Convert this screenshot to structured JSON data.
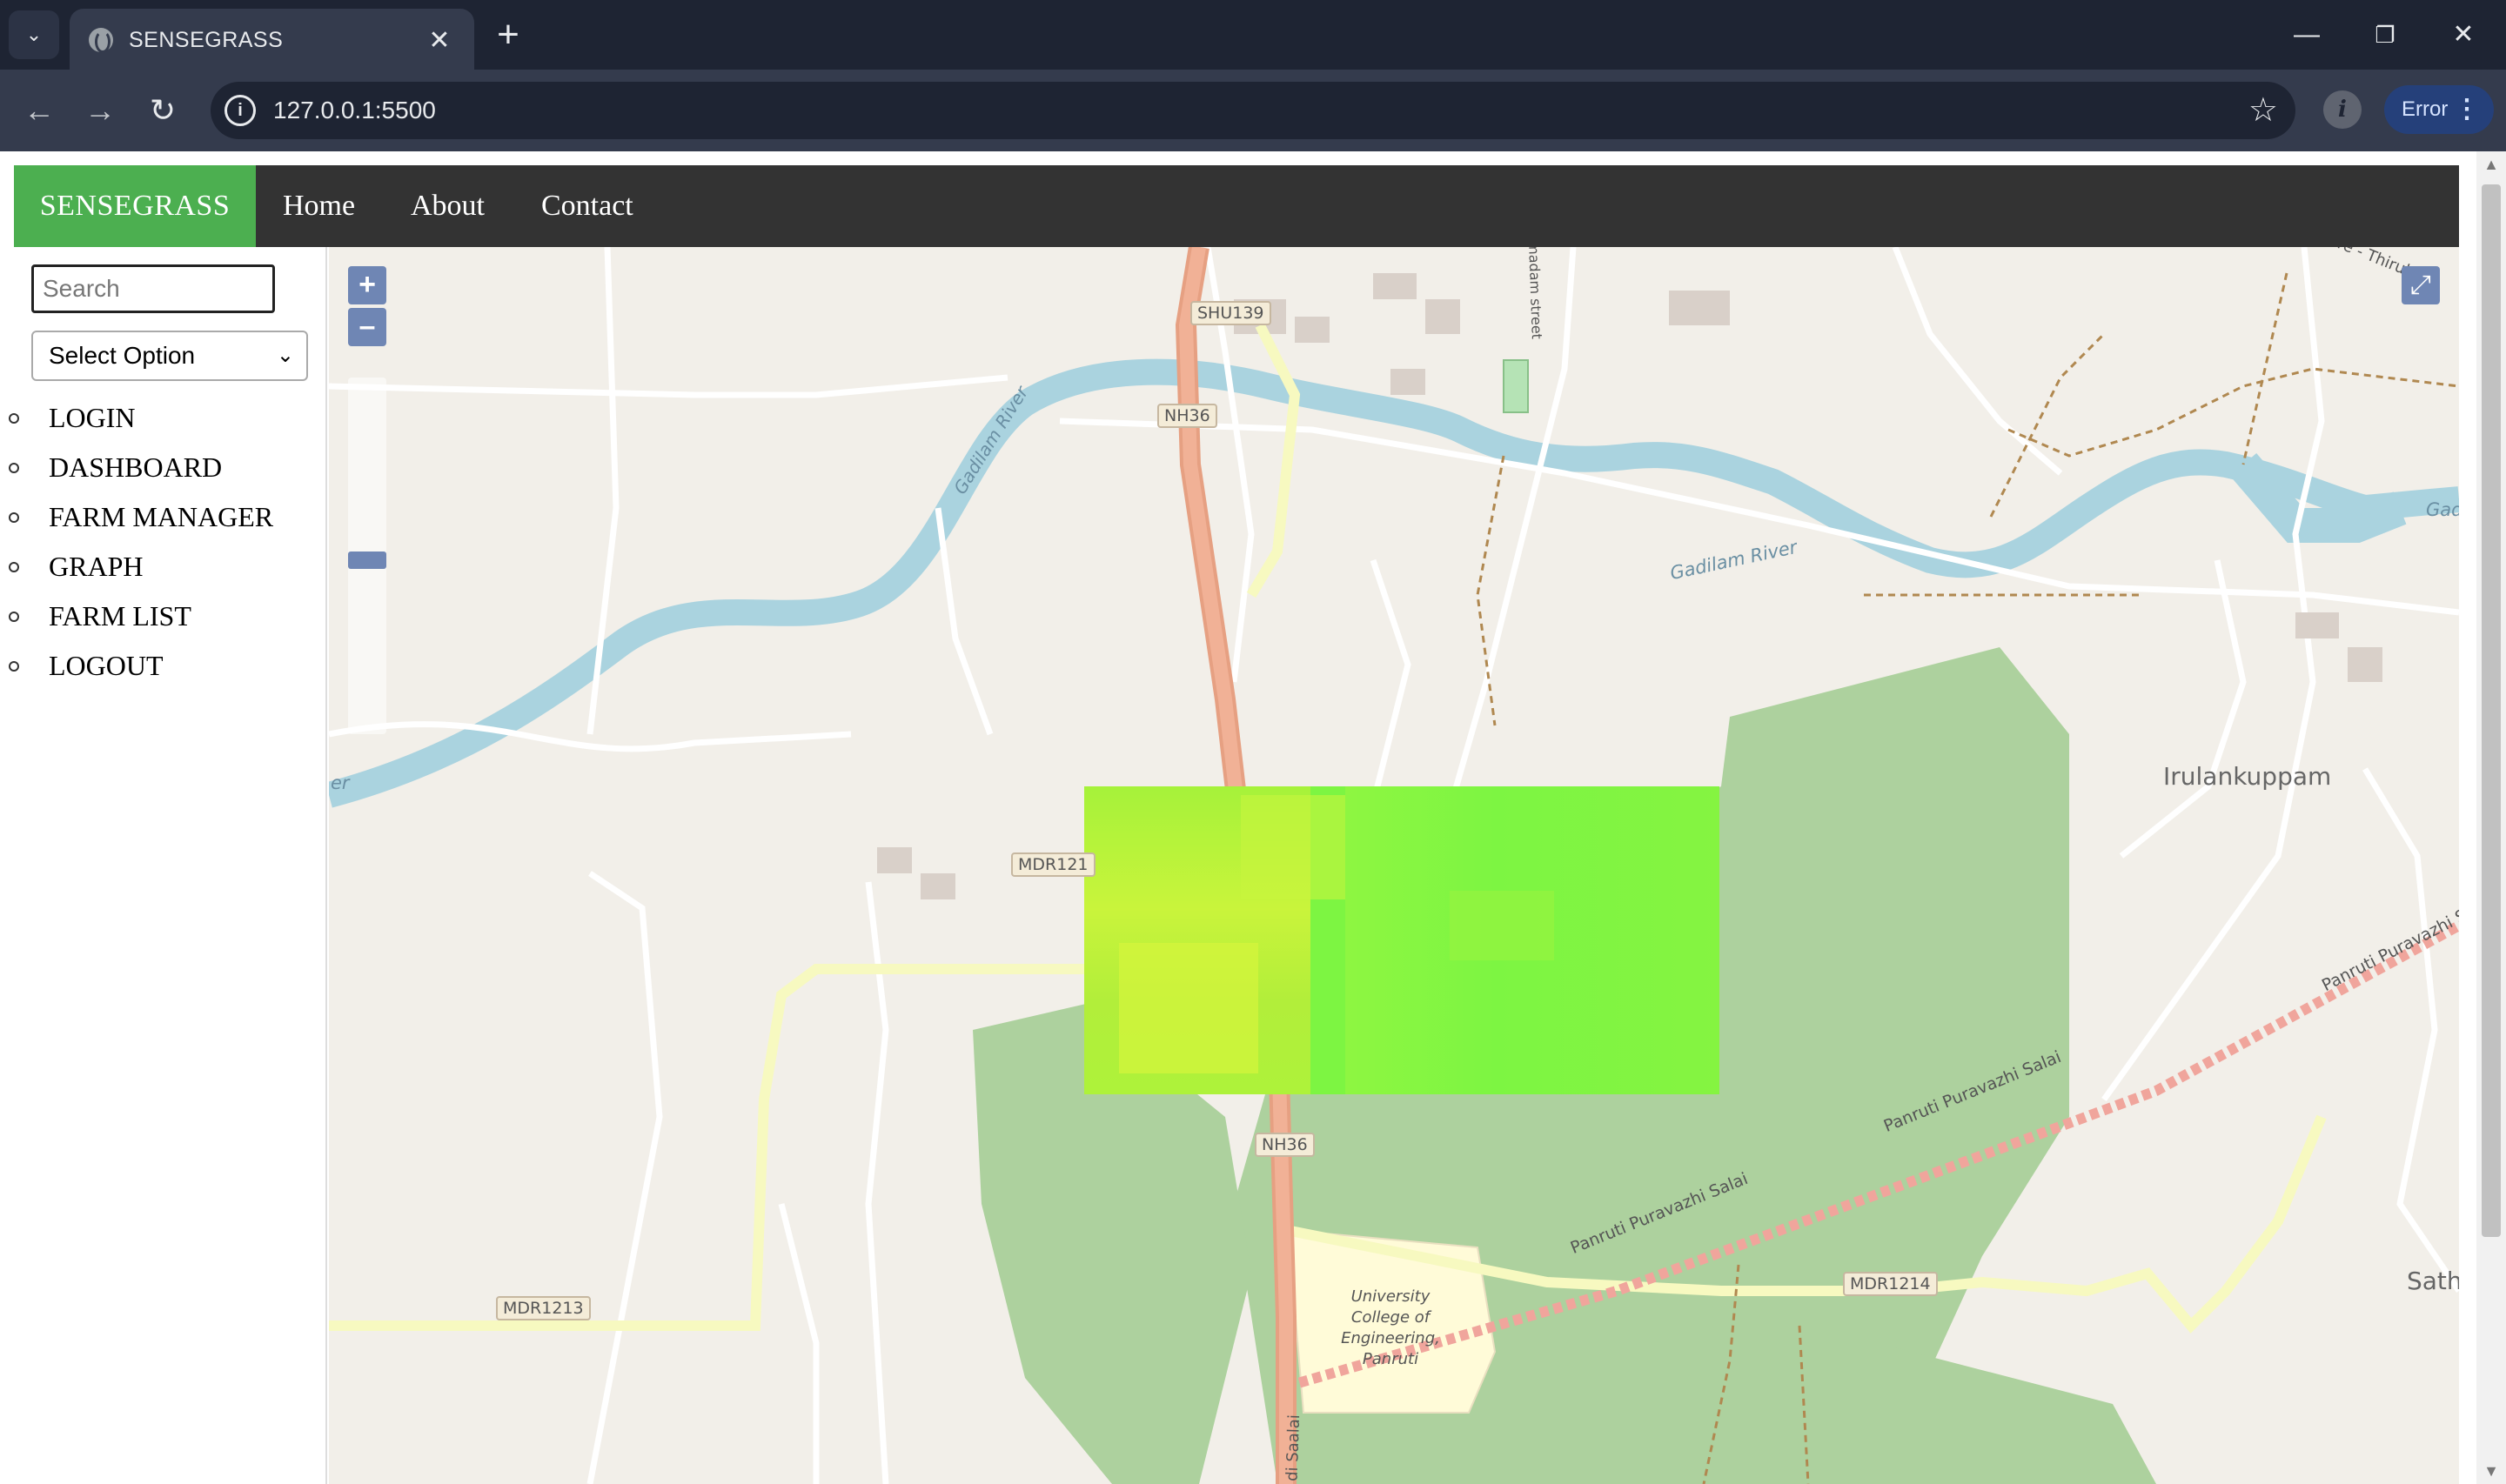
{
  "browser": {
    "tab_title": "SENSEGRASS",
    "url": "127.0.0.1:5500",
    "error_label": "Error"
  },
  "navbar": {
    "brand": "SENSEGRASS",
    "links": [
      "Home",
      "About",
      "Contact"
    ]
  },
  "sidebar": {
    "search_placeholder": "Search",
    "select_value": "Select Option",
    "menu": [
      "LOGIN",
      "DASHBOARD",
      "FARM MANAGER",
      "GRAPH",
      "FARM LIST",
      "LOGOUT"
    ]
  },
  "map": {
    "zoom_in": "+",
    "zoom_out": "–",
    "labels": {
      "river_1": "Gadilam River",
      "river_2": "Gadilam River",
      "river_3": "Gad",
      "river_4": "er",
      "village": "Irulankuppam",
      "road_name_1": "Panruti Puravazhi Salai",
      "road_name_2": "Panruti Puravazhi Salai",
      "road_name_3": "Panruti Puravazhi Salai",
      "street": "madam street",
      "corner": "re - Thirukku",
      "college": "University College of Engineering, Panruti",
      "edge": "Sath",
      "bottom": "di Saalai"
    },
    "shields": [
      "SHU139",
      "NH36",
      "MDR121",
      "NH36",
      "MDR1213",
      "MDR1214"
    ]
  }
}
